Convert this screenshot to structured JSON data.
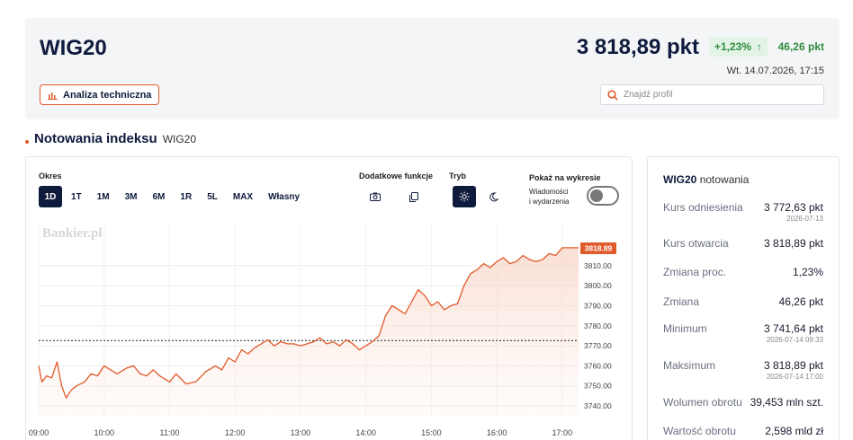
{
  "header": {
    "index_name": "WIG20",
    "price": "3 818,89 pkt",
    "pct_change": "+1,23%",
    "pct_arrow": "↑",
    "abs_change": "46,26 pkt",
    "timestamp": "Wt. 14.07.2026, 17:15",
    "tech_analysis_label": "Analiza techniczna",
    "search_placeholder": "Znajdź profil"
  },
  "section": {
    "title": "Notowania indeksu",
    "subtitle": "WIG20"
  },
  "controls": {
    "period_label": "Okres",
    "periods": [
      "1D",
      "1T",
      "1M",
      "3M",
      "6M",
      "1R",
      "5L",
      "MAX",
      "Własny"
    ],
    "active_period": "1D",
    "extra_label": "Dodatkowe funkcje",
    "mode_label": "Tryb",
    "show_label": "Pokaż na wykresie",
    "news_toggle_label_1": "Wiadomości",
    "news_toggle_label_2": "i wydarzenia"
  },
  "watermark": "Bankier.pl",
  "chart_data": {
    "type": "line",
    "x_labels": [
      "09:00",
      "10:00",
      "11:00",
      "12:00",
      "13:00",
      "14:00",
      "15:00",
      "16:00",
      "17:00"
    ],
    "y_ticks": [
      "3810.00",
      "3800.00",
      "3790.00",
      "3780.00",
      "3770.00",
      "3760.00",
      "3750.00",
      "3740.00"
    ],
    "ylim": [
      3736,
      3822
    ],
    "reference_value": 3772.63,
    "last_label": "3818.89",
    "line_color": "#e05a2b",
    "points": [
      [
        9.0,
        3760
      ],
      [
        9.05,
        3752
      ],
      [
        9.12,
        3755
      ],
      [
        9.2,
        3754
      ],
      [
        9.28,
        3762
      ],
      [
        9.35,
        3750
      ],
      [
        9.42,
        3744
      ],
      [
        9.5,
        3748
      ],
      [
        9.58,
        3750
      ],
      [
        9.7,
        3752
      ],
      [
        9.8,
        3756
      ],
      [
        9.9,
        3755
      ],
      [
        10.0,
        3760
      ],
      [
        10.1,
        3758
      ],
      [
        10.2,
        3756
      ],
      [
        10.35,
        3759
      ],
      [
        10.45,
        3760
      ],
      [
        10.55,
        3756
      ],
      [
        10.65,
        3755
      ],
      [
        10.75,
        3758
      ],
      [
        10.85,
        3755
      ],
      [
        11.0,
        3752
      ],
      [
        11.1,
        3756
      ],
      [
        11.25,
        3751
      ],
      [
        11.4,
        3752
      ],
      [
        11.55,
        3757
      ],
      [
        11.7,
        3760
      ],
      [
        11.8,
        3758
      ],
      [
        11.9,
        3764
      ],
      [
        12.0,
        3762
      ],
      [
        12.1,
        3768
      ],
      [
        12.2,
        3766
      ],
      [
        12.3,
        3769
      ],
      [
        12.4,
        3771
      ],
      [
        12.5,
        3773
      ],
      [
        12.6,
        3770
      ],
      [
        12.7,
        3772
      ],
      [
        12.8,
        3771
      ],
      [
        12.9,
        3771
      ],
      [
        13.0,
        3770
      ],
      [
        13.1,
        3771
      ],
      [
        13.2,
        3772
      ],
      [
        13.3,
        3774
      ],
      [
        13.4,
        3771
      ],
      [
        13.5,
        3772
      ],
      [
        13.6,
        3770
      ],
      [
        13.7,
        3773
      ],
      [
        13.8,
        3771
      ],
      [
        13.9,
        3768
      ],
      [
        14.0,
        3770
      ],
      [
        14.1,
        3772
      ],
      [
        14.2,
        3775
      ],
      [
        14.3,
        3785
      ],
      [
        14.4,
        3790
      ],
      [
        14.5,
        3788
      ],
      [
        14.6,
        3786
      ],
      [
        14.7,
        3792
      ],
      [
        14.8,
        3798
      ],
      [
        14.9,
        3795
      ],
      [
        15.0,
        3790
      ],
      [
        15.1,
        3792
      ],
      [
        15.2,
        3788
      ],
      [
        15.3,
        3790
      ],
      [
        15.4,
        3791
      ],
      [
        15.5,
        3800
      ],
      [
        15.6,
        3806
      ],
      [
        15.7,
        3808
      ],
      [
        15.8,
        3811
      ],
      [
        15.9,
        3809
      ],
      [
        16.0,
        3812
      ],
      [
        16.1,
        3814
      ],
      [
        16.2,
        3811
      ],
      [
        16.3,
        3812
      ],
      [
        16.4,
        3815
      ],
      [
        16.5,
        3813
      ],
      [
        16.6,
        3812
      ],
      [
        16.7,
        3813
      ],
      [
        16.8,
        3816
      ],
      [
        16.9,
        3815
      ],
      [
        17.0,
        3818.89
      ],
      [
        17.25,
        3818.89
      ]
    ]
  },
  "side": {
    "title_bold": "WIG20",
    "title_rest": "notowania",
    "rows": [
      {
        "label": "Kurs odniesienia",
        "value": "3 772,63 pkt",
        "sub": "2026-07-13"
      },
      {
        "label": "Kurs otwarcia",
        "value": "3 818,89 pkt",
        "sub": ""
      },
      {
        "label": "Zmiana proc.",
        "value": "1,23%",
        "sub": ""
      },
      {
        "label": "Zmiana",
        "value": "46,26 pkt",
        "sub": ""
      },
      {
        "label": "Minimum",
        "value": "3 741,64 pkt",
        "sub": "2026-07-14 09:33"
      },
      {
        "label": "Maksimum",
        "value": "3 818,89 pkt",
        "sub": "2026-07-14 17:00"
      },
      {
        "label": "Wolumen obrotu",
        "value": "39,453 mln szt.",
        "sub": ""
      },
      {
        "label": "Wartość obrotu",
        "value": "2,598 mld zł",
        "sub": ""
      }
    ]
  }
}
